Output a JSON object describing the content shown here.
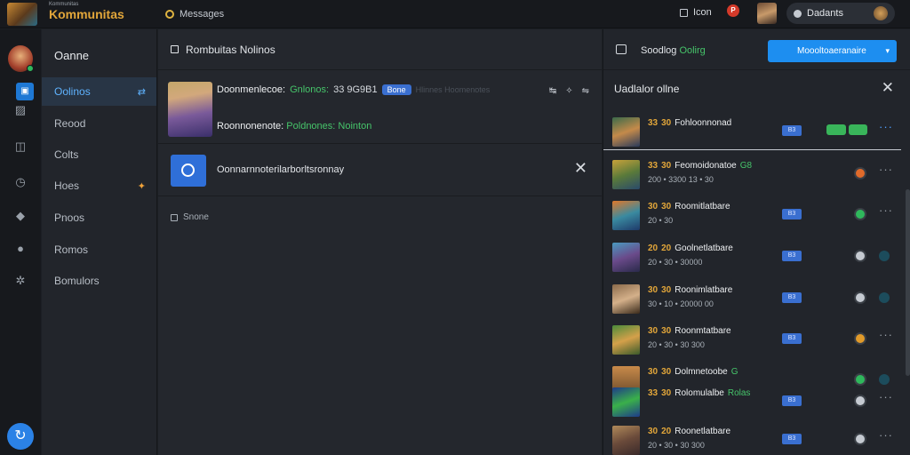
{
  "topbar": {
    "brand_small": "Kommunitas",
    "brand": "Kommunitas",
    "search_label": "Messages",
    "item_label": "Icon",
    "notif_count": "P",
    "user_name": "Dadants"
  },
  "rail": {
    "icons": [
      "home-icon",
      "image-icon",
      "chart-icon",
      "clock-icon",
      "puzzle-icon",
      "disc-icon",
      "gear-icon"
    ],
    "fab_icon": "link-icon"
  },
  "nav": {
    "header": "Oanne",
    "items": [
      {
        "label": "Oolinos",
        "tail": "⇄"
      },
      {
        "label": "Reood",
        "tail": ""
      },
      {
        "label": "Colts",
        "tail": ""
      },
      {
        "label": "Hoes",
        "tail": "✦"
      },
      {
        "label": "Pnoos",
        "tail": ""
      },
      {
        "label": "Romos",
        "tail": ""
      },
      {
        "label": "Bomulors",
        "tail": ""
      }
    ]
  },
  "center": {
    "title": "Rombuitas Nolinos",
    "msg1": {
      "name": "Doonmenlecoe:",
      "green": "Gnlonos:",
      "num": "33 9G9B1",
      "badge": "Bone",
      "muted": "Hlinnes Hoomenotes",
      "actions": [
        "↹",
        "✧",
        "⇋"
      ],
      "line2_name": "Roonnonenote:",
      "line2_green": "Poldnones: Nointon"
    },
    "msg2": {
      "text": "Oonnarnnoterilarborltsronnay"
    },
    "filter": "Snone"
  },
  "right": {
    "top_label": "Soodlog",
    "top_label_green": "Oolirg",
    "button_label": "Moooltoaeranaire",
    "header": "Uadlalor ollne",
    "rows": [
      {
        "tags": [
          "33",
          "30"
        ],
        "name": "Fohloonnonad",
        "gtag": "",
        "sub": "",
        "chip": "B3",
        "status": "toggle",
        "more": "···",
        "more_blue": true,
        "avatar": "linear-gradient(160deg,#3a6a4a,#c48a4a 50%,#2a3a5a)"
      },
      {
        "tags": [
          "33",
          "30"
        ],
        "name": "Feomoidonatoe",
        "gtag": "G8",
        "sub": "200 • 3300 13 • 30",
        "chip": "",
        "status": "#e06a2a",
        "more": "···",
        "more_blue": false,
        "avatar": "linear-gradient(160deg,#c8a23a,#5a7a3a 50%,#2a4a6a)"
      },
      {
        "tags": [
          "30",
          "30"
        ],
        "name": "Roomitlatbare",
        "gtag": "",
        "sub": "20 • 30",
        "chip": "B3",
        "status": "#2fb85c",
        "more": "···",
        "more_blue": false,
        "avatar": "linear-gradient(160deg,#e0782a,#3a8aa0 50%,#1e3a6a)"
      },
      {
        "tags": [
          "20",
          "20"
        ],
        "name": "Goolnetlatbare",
        "gtag": "",
        "sub": "20 • 30 • 30000",
        "chip": "B3",
        "status": "#c5cad1",
        "more": "•",
        "more_blue": true,
        "avatar": "linear-gradient(160deg,#4a9ac0,#6a4a8a 50%,#2a2a4a)"
      },
      {
        "tags": [
          "30",
          "30"
        ],
        "name": "Roonimlatbare",
        "gtag": "",
        "sub": "30 • 10 • 20000 00",
        "chip": "B3",
        "status": "#c5cad1",
        "more": "•",
        "more_blue": true,
        "avatar": "linear-gradient(160deg,#8a6a4a,#d4b08a 50%,#3a2a1a)"
      },
      {
        "tags": [
          "30",
          "30"
        ],
        "name": "Roonmtatbare",
        "gtag": "",
        "sub": "20 • 30 • 30 300",
        "chip": "B3",
        "status": "#e09a2a",
        "more": "···",
        "more_blue": false,
        "avatar": "linear-gradient(160deg,#4a8a3a,#d4a04a 50%,#3a5a2a)"
      },
      {
        "tags": [
          "30",
          "30"
        ],
        "name": "Dolmnetoobe",
        "gtag": "G",
        "sub": "",
        "chip": "",
        "status": "#2fb85c",
        "more": "•",
        "more_blue": true,
        "avatar": "linear-gradient(180deg,#c88a4a,#6a4a2a)"
      },
      {
        "tags": [
          "33",
          "30"
        ],
        "name": "Rolomulalbe",
        "gtag": "Rolas",
        "sub": "",
        "chip": "B3",
        "status": "#c5cad1",
        "more": "···",
        "more_blue": false,
        "avatar": "linear-gradient(160deg,#1e3a8a,#3ab04a 50%,#1e3a8a)"
      },
      {
        "tags": [
          "30",
          "20"
        ],
        "name": "Roonetlatbare",
        "gtag": "",
        "sub": "20 • 30 • 30 300",
        "chip": "B3",
        "status": "#c5cad1",
        "more": "···",
        "more_blue": false,
        "avatar": "linear-gradient(160deg,#b08a5a,#6a4a3a 50%,#3a2a2a)"
      }
    ]
  }
}
